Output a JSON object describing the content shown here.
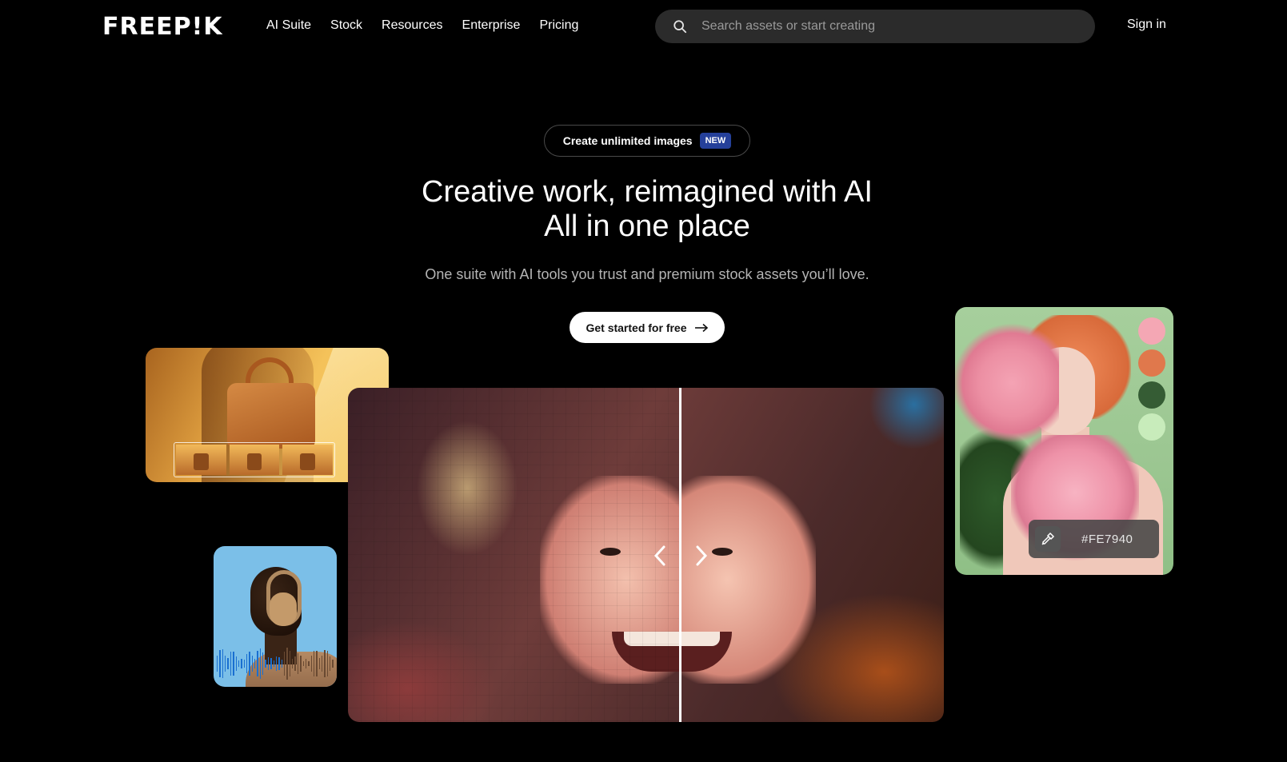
{
  "header": {
    "logo": "FREEP!K",
    "nav": [
      "AI Suite",
      "Stock",
      "Resources",
      "Enterprise",
      "Pricing"
    ],
    "search_placeholder": "Search assets or start creating",
    "sign_in": "Sign in"
  },
  "hero": {
    "pill_text": "Create unlimited images",
    "pill_badge": "NEW",
    "headline_line1": "Creative work, reimagined with AI",
    "headline_line2": "All in one place",
    "subline": "One suite with AI tools you trust and premium stock assets you’ll love.",
    "cta_label": "Get started for free"
  },
  "showcase": {
    "color_picker_value": "#FE7940",
    "swatches": [
      "#f4a7b4",
      "#e0784c",
      "#355c34",
      "#c8ecbb"
    ]
  },
  "colors": {
    "background": "#000000",
    "search_bg": "#2b2b2b",
    "badge": "#25409a"
  }
}
